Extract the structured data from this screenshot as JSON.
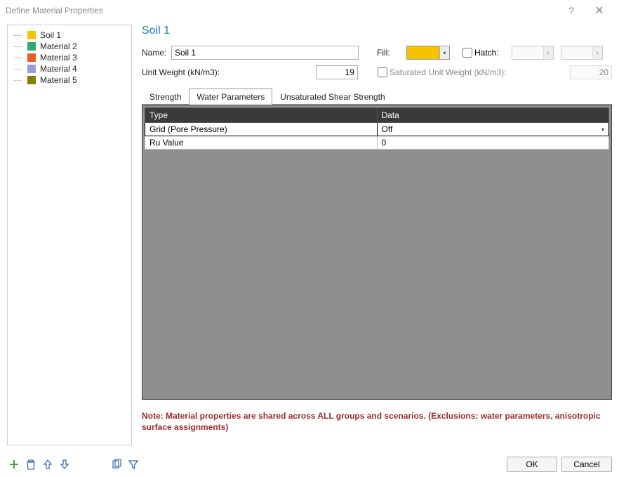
{
  "window": {
    "title": "Define Material Properties"
  },
  "sidebar": {
    "items": [
      {
        "label": "Soil 1",
        "color": "gold"
      },
      {
        "label": "Material 2",
        "color": "green"
      },
      {
        "label": "Material 3",
        "color": "orange"
      },
      {
        "label": "Material 4",
        "color": "lav"
      },
      {
        "label": "Material 5",
        "color": "olive"
      }
    ]
  },
  "main": {
    "title": "Soil 1",
    "name_label": "Name:",
    "name_value": "Soil 1",
    "fill_label": "Fill:",
    "fill_color": "#f7c300",
    "hatch_label": "Hatch:",
    "unitweight_label": "Unit Weight (kN/m3):",
    "unitweight_value": "19",
    "sat_label": "Saturated Unit Weight (kN/m3):",
    "sat_value": "20"
  },
  "tabs": {
    "strength": "Strength",
    "water": "Water Parameters",
    "unsat": "Unsaturated Shear Strength"
  },
  "grid": {
    "col_type": "Type",
    "col_data": "Data",
    "rows": [
      {
        "type": "Grid (Pore Pressure)",
        "data": "Off"
      },
      {
        "type": "Ru Value",
        "data": "0"
      }
    ]
  },
  "note": "Note: Material properties are shared across ALL groups and scenarios. (Exclusions: water parameters, anisotropic surface assignments)",
  "buttons": {
    "ok": "OK",
    "cancel": "Cancel"
  }
}
